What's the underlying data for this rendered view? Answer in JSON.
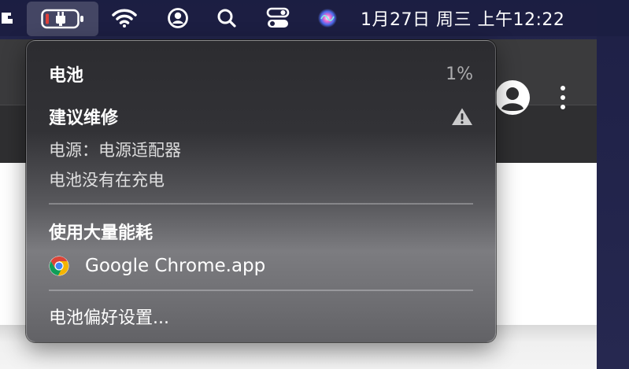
{
  "menubar": {
    "clock": "1月27日 周三 上午12:22",
    "icons": [
      "battery-icon",
      "wifi-icon",
      "user-icon",
      "search-icon",
      "control-center-icon",
      "siri-icon"
    ]
  },
  "battery_menu": {
    "title": "电池",
    "percent": "1%",
    "service_label": "建议维修",
    "power_source": "电源：电源适配器",
    "charging_status": "电池没有在充电",
    "energy_header": "使用大量能耗",
    "apps": [
      {
        "name": "Google Chrome.app",
        "icon": "chrome-icon"
      }
    ],
    "preferences": "电池偏好设置..."
  },
  "colors": {
    "menubar_bg": "#1c1e42",
    "battery_level_low": "#e0403a",
    "menu_bg_top": "#2c2c30",
    "menu_bg_bottom": "#626266"
  }
}
